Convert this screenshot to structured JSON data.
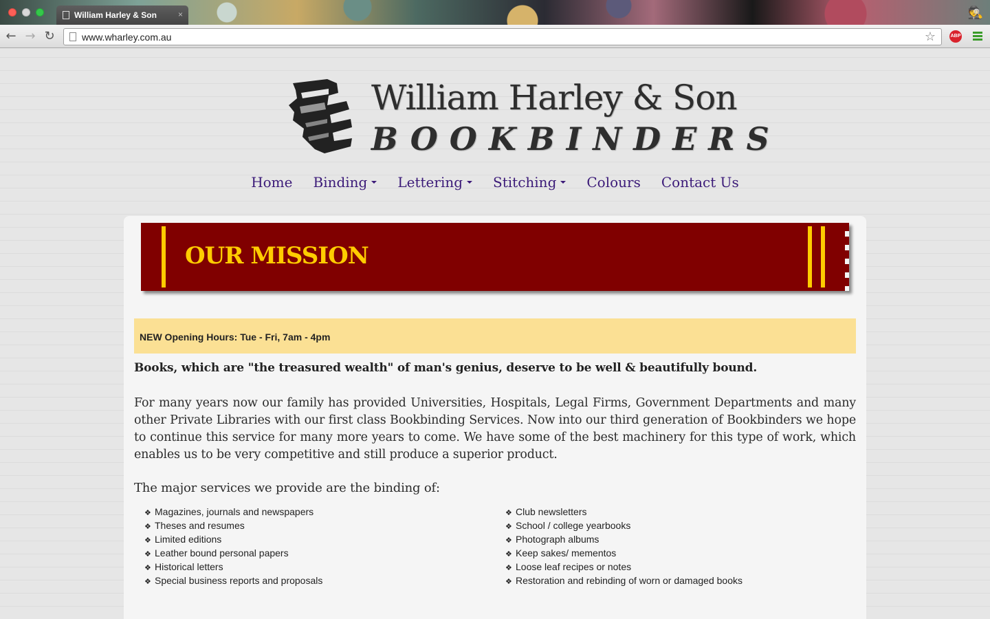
{
  "browser": {
    "tab_title": "William Harley & Son",
    "tab_close": "×",
    "url": "www.wharley.com.au",
    "abp_label": "ABP",
    "icons": {
      "back": "arrow-left-icon",
      "forward": "arrow-right-icon",
      "reload": "reload-icon",
      "bookmark": "star-icon",
      "adblock": "adblock-icon",
      "menu": "menu-icon",
      "incognito": "incognito-icon"
    }
  },
  "site": {
    "logo_name": "William Harley & Son",
    "logo_sub": "BOOKBINDERS",
    "logo_icon": "books-stack-icon"
  },
  "nav": [
    {
      "label": "Home",
      "dropdown": false
    },
    {
      "label": "Binding",
      "dropdown": true
    },
    {
      "label": "Lettering",
      "dropdown": true
    },
    {
      "label": "Stitching",
      "dropdown": true
    },
    {
      "label": "Colours",
      "dropdown": false
    },
    {
      "label": "Contact Us",
      "dropdown": false
    }
  ],
  "main": {
    "banner_title": "OUR MISSION",
    "hours_notice": "NEW Opening Hours: Tue - Fri, 7am - 4pm",
    "lead": "Books, which are \"the treasured wealth\" of man's genius, deserve to be well & beautifully bound.",
    "body": "For many years now our family has provided Universities, Hospitals, Legal Firms, Government Departments and many other Private Libraries with our first class Bookbinding Services. Now into our third generation of Bookbinders we hope to continue this service for many more years to come. We have some of the best machinery for this type of work, which enables us to be very competitive and still produce a superior product.",
    "services_intro": "The major services we provide are the binding of:",
    "bullet": "❖",
    "services_left": [
      "Magazines, journals and newspapers",
      "Theses and resumes",
      "Limited editions",
      "Leather bound personal papers",
      "Historical letters",
      "Special business reports and proposals"
    ],
    "services_right": [
      "Club newsletters",
      "School / college yearbooks",
      "Photograph albums",
      "Keep sakes/ mementos",
      "Loose leaf recipes or notes",
      "Restoration and rebinding of worn or damaged books"
    ]
  },
  "colors": {
    "banner_bg": "#800000",
    "banner_accent": "#ffcc00",
    "nav_link": "#3b1a78",
    "hours_bg": "#fbe094"
  }
}
